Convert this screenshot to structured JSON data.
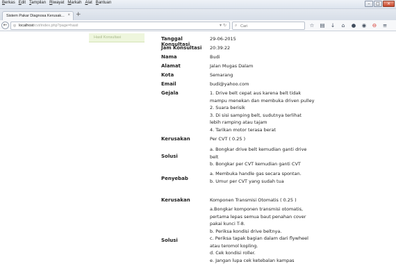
{
  "menu": [
    "Berkas",
    "Edit",
    "Tampilan",
    "Riwayat",
    "Markah",
    "Alat",
    "Bantuan"
  ],
  "window_controls": [
    "minimize",
    "maximize",
    "close"
  ],
  "tab": {
    "title": "Sistem Pakar Diagnosa Kerusak...",
    "close": "×"
  },
  "new_tab": "+",
  "url": {
    "host": "localhost",
    "path": "/cvt/index.php?page=hasil"
  },
  "search": {
    "placeholder": "Cari"
  },
  "sidebar": {
    "item": "Hasil Konsultasi"
  },
  "info": {
    "tanggal": {
      "label": "Tanggal Konsultasi",
      "value": "29-06-2015"
    },
    "jam": {
      "label": "Jam Konsultasi",
      "value": "20:39:22"
    },
    "nama": {
      "label": "Nama",
      "value": "Budi"
    },
    "alamat": {
      "label": "Alamat",
      "value": "Jalan Mugas Dalam"
    },
    "kota": {
      "label": "Kota",
      "value": "Semarang"
    },
    "email": {
      "label": "Email",
      "value": "budi@yahoo.com"
    }
  },
  "gejala": {
    "label": "Gejala",
    "lines": [
      "1. Drive belt cepat aus karena belt tidak",
      "mampu menekan dan membuka driven pulley",
      "2. Suara berisik",
      "3. Di sisi samping belt, sudutnya terlihat",
      "lebih ramping atau tajam",
      "4. Tarikan motor terasa berat"
    ]
  },
  "result1": {
    "kerusakan_label": "Kerusakan",
    "kerusakan_value": "Per CVT ( 0.25 )",
    "solusi_label": "Solusi",
    "solusi_lines": [
      "a. Bongkar drive belt kemudian ganti drive",
      "belt",
      "b. Bongkar per CVT kemudian ganti CVT"
    ],
    "penyebab_label": "Penyebab",
    "penyebab_lines": [
      "a. Membuka handle gas secara spontan.",
      "b. Umur per CVT yang sudah tua"
    ]
  },
  "result2": {
    "kerusakan_label": "Kerusakan",
    "kerusakan_value": "Komponen Transmisi Otomatis ( 0.25 )",
    "solusi_label": "Solusi",
    "solusi_lines": [
      "a.Bongkar komponen transmisi otomatis,",
      "pertama lepas semua baut penahan cover",
      "pakai kunci T-8.",
      "b. Periksa kondisi drive beltnya.",
      "c. Periksa tapak bagian dalam dari flywheel",
      "atau teromol kopling.",
      "d. Cek kondisi roller.",
      "e. Jangan lupa cek ketebalan kampas"
    ]
  }
}
